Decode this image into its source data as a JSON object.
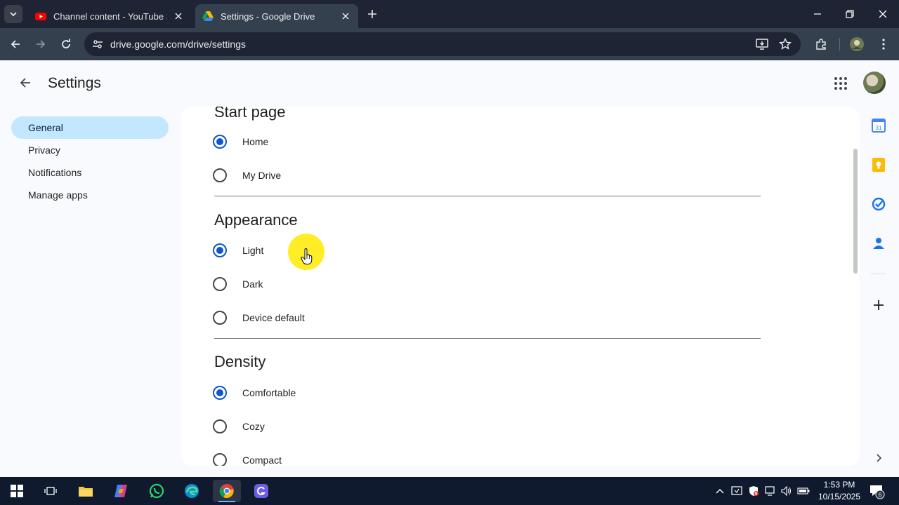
{
  "browser": {
    "tabs": [
      {
        "title": "Channel content - YouTube Studio",
        "favicon": "youtube-icon",
        "active": false
      },
      {
        "title": "Settings - Google Drive",
        "favicon": "google-drive-icon",
        "active": true
      }
    ],
    "url": "drive.google.com/drive/settings"
  },
  "header": {
    "title": "Settings"
  },
  "sidebar": {
    "items": [
      {
        "label": "General",
        "active": true
      },
      {
        "label": "Privacy",
        "active": false
      },
      {
        "label": "Notifications",
        "active": false
      },
      {
        "label": "Manage apps",
        "active": false
      }
    ]
  },
  "sections": {
    "start_page": {
      "title": "Start page",
      "options": [
        {
          "label": "Home",
          "checked": true
        },
        {
          "label": "My Drive",
          "checked": false
        }
      ]
    },
    "appearance": {
      "title": "Appearance",
      "options": [
        {
          "label": "Light",
          "checked": true
        },
        {
          "label": "Dark",
          "checked": false
        },
        {
          "label": "Device default",
          "checked": false
        }
      ]
    },
    "density": {
      "title": "Density",
      "options": [
        {
          "label": "Comfortable",
          "checked": true
        },
        {
          "label": "Cozy",
          "checked": false
        },
        {
          "label": "Compact",
          "checked": false
        }
      ]
    }
  },
  "side_panel": {
    "calendar_day": "31"
  },
  "taskbar": {
    "time": "1:53 PM",
    "date": "10/15/2025",
    "notification_count": "6"
  },
  "colors": {
    "accent": "#0b57d0",
    "nav_active_bg": "#c2e7ff",
    "cursor_highlight": "#ffeb00"
  }
}
